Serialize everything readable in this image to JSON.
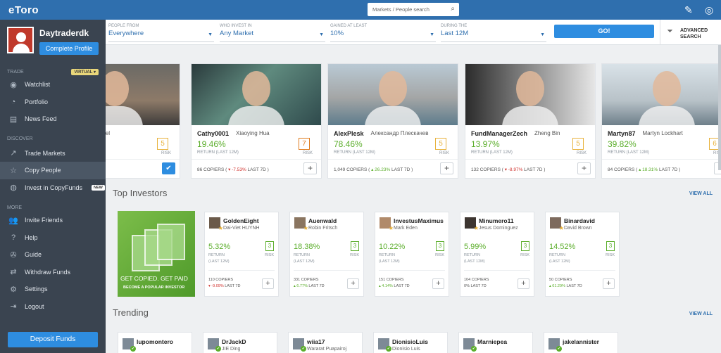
{
  "sidebar": {
    "logo": "eToro",
    "username": "Daytraderdk",
    "complete_profile": "Complete Profile",
    "trade_label": "TRADE",
    "virtual_label": "VIRTUAL ▾",
    "discover_label": "DISCOVER",
    "more_label": "MORE",
    "items": [
      {
        "label": "Watchlist",
        "icon": "eye-icon",
        "glyph": "◉"
      },
      {
        "label": "Portfolio",
        "icon": "pie-chart-icon",
        "glyph": "◔"
      },
      {
        "label": "News Feed",
        "icon": "news-icon",
        "glyph": "▤"
      },
      {
        "label": "Trade Markets",
        "icon": "trend-icon",
        "glyph": "↗"
      },
      {
        "label": "Copy People",
        "icon": "star-icon",
        "glyph": "☆"
      },
      {
        "label": "Invest in CopyFunds",
        "icon": "copyfunds-icon",
        "glyph": "◍",
        "badge": "NEW"
      },
      {
        "label": "Invite Friends",
        "icon": "people-icon",
        "glyph": "👥"
      },
      {
        "label": "Help",
        "icon": "help-icon",
        "glyph": "?"
      },
      {
        "label": "Guide",
        "icon": "guide-icon",
        "glyph": "✇"
      },
      {
        "label": "Withdraw Funds",
        "icon": "withdraw-icon",
        "glyph": "⇄"
      },
      {
        "label": "Settings",
        "icon": "gear-icon",
        "glyph": "⚙"
      },
      {
        "label": "Logout",
        "icon": "logout-icon",
        "glyph": "⇥"
      }
    ],
    "deposit": "Deposit Funds"
  },
  "topbar": {
    "search_placeholder": "Markets / People search"
  },
  "filters": {
    "people_from": {
      "label": "PEOPLE FROM",
      "value": "Everywhere"
    },
    "who_invest": {
      "label": "WHO INVEST IN",
      "value": "Any Market"
    },
    "gained": {
      "label": "GAINED AT LEAST",
      "value": "10%"
    },
    "during": {
      "label": "DURING THE",
      "value": "Last 12M"
    },
    "go": "GO!",
    "advanced_1": "ADVANCED",
    "advanced_2": "SEARCH"
  },
  "featured": [
    {
      "name": "",
      "real": "Jan Morten Tøndel",
      "ret": "",
      "retlbl": "",
      "risk": "5",
      "copiers": "LAST 7D )",
      "change": "",
      "action": "✔"
    },
    {
      "name": "Cathy0001",
      "real": "Xiaoying Hua",
      "ret": "19.46%",
      "retlbl": "RETURN (LAST 12M)",
      "risk": "7",
      "copiers": "86 COPIERS ( ",
      "change": "▾ -7.53%",
      "tail": " LAST 7D )",
      "action": "+"
    },
    {
      "name": "AlexPlesk",
      "real": "Александр Плескачев",
      "ret": "78.46%",
      "retlbl": "RETURN (LAST 12M)",
      "risk": "5",
      "copiers": "1,049 COPIERS ( ",
      "change": "▴ 26.23%",
      "tail": " LAST 7D )",
      "action": "+"
    },
    {
      "name": "FundManagerZech",
      "real": "Zheng Bin",
      "ret": "13.97%",
      "retlbl": "RETURN (LAST 12M)",
      "risk": "5",
      "copiers": "132 COPIERS ( ",
      "change": "▾ -8.97%",
      "tail": " LAST 7D )",
      "action": "+"
    },
    {
      "name": "Martyn87",
      "real": "Martyn Lockhart",
      "ret": "39.82%",
      "retlbl": "RETURN (LAST 12M)",
      "risk": "6",
      "copiers": "84 COPIERS ( ",
      "change": "▴ 18.31%",
      "tail": " LAST 7D )",
      "action": "+"
    }
  ],
  "risk_label": "RISK",
  "top_investors": {
    "title": "Top Investors",
    "view_all": "VIEW ALL",
    "promo_1": "GET COPIED. GET PAID",
    "promo_2": "BECOME A POPULAR INVESTOR",
    "cards": [
      {
        "name": "GoldenEight",
        "real": "Dai-Viet HUYNH",
        "ret": "5.32%",
        "risk": "3",
        "copiers": "110 COPIERS",
        "change": "▾ -9.09%",
        "dir": "down"
      },
      {
        "name": "Auenwald",
        "real": "Robin Fritsch",
        "ret": "18.38%",
        "risk": "3",
        "copiers": "331 COPIERS",
        "change": "▴ 6.77%",
        "dir": "up"
      },
      {
        "name": "InvestusMaximus",
        "real": "Mark Eden",
        "ret": "10.22%",
        "risk": "3",
        "copiers": "151 COPIERS",
        "change": "▴ 4.14%",
        "dir": "up"
      },
      {
        "name": "Minumero11",
        "real": "Jesus Dominguez",
        "ret": "5.99%",
        "risk": "3",
        "copiers": "104 COPIERS",
        "change": "0%",
        "dir": "flat"
      },
      {
        "name": "Binardavid",
        "real": "David Brown",
        "ret": "14.52%",
        "risk": "3",
        "copiers": "50 COPIERS",
        "change": "▴ 61.29%",
        "dir": "up"
      }
    ],
    "return_lbl_1": "RETURN",
    "return_lbl_2": "(LAST 12M)",
    "last7": "LAST 7D"
  },
  "trending": {
    "title": "Trending",
    "view_all": "VIEW ALL",
    "cards": [
      {
        "name": "lupomontero",
        "real": ""
      },
      {
        "name": "DrJackD",
        "real": "JIE Ding"
      },
      {
        "name": "wiia17",
        "real": "Wararat Puapairoj"
      },
      {
        "name": "DionisioLuis",
        "real": "Dionisio Luis"
      },
      {
        "name": "Marniepea",
        "real": ""
      },
      {
        "name": "jakelannister",
        "real": ""
      }
    ]
  },
  "colors": {
    "brand": "#2f6fae",
    "accent": "#2e8de0",
    "positive": "#5cae2c",
    "negative": "#d0312d",
    "sidebar": "#3a4450"
  }
}
